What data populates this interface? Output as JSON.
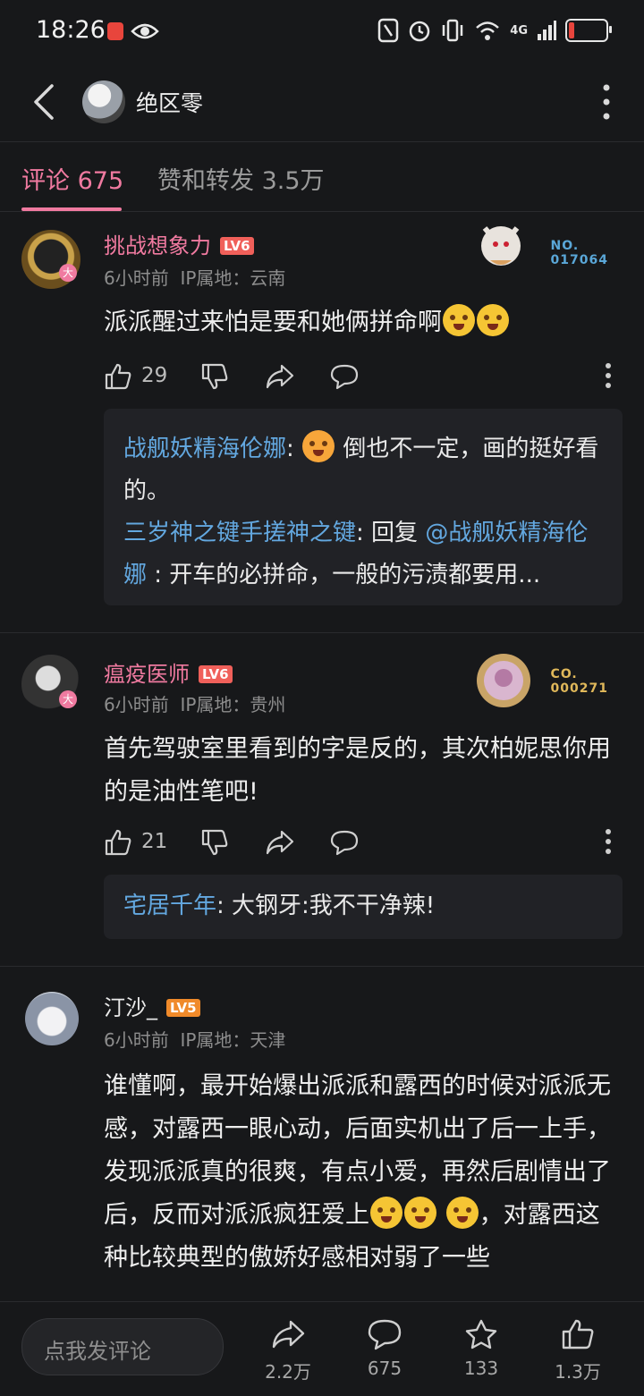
{
  "status_bar": {
    "time": "18:26",
    "network": "4G"
  },
  "header": {
    "title": "绝区零"
  },
  "tabs": [
    {
      "label": "评论 675"
    },
    {
      "label": "赞和转发 3.5万"
    }
  ],
  "comments": [
    {
      "username": "挑战想象力",
      "level": "LV6",
      "time": "6小时前",
      "ip": "IP属地：云南",
      "text": "派派醒过来怕是要和她俩拼命啊",
      "likes": "29",
      "badge_no": "NO.",
      "badge_num": "017064",
      "replies": [
        {
          "name": "战舰妖精海伦娜",
          "text": "倒也不一定，画的挺好看的。"
        },
        {
          "name": "三岁神之键手搓神之键",
          "text_prefix": "回复 ",
          "mention": "@战舰妖精海伦娜",
          "text": " : 开车的必拼命，一般的污渍都要用..."
        }
      ]
    },
    {
      "username": "瘟疫医师",
      "level": "LV6",
      "time": "6小时前",
      "ip": "IP属地：贵州",
      "text": "首先驾驶室里看到的字是反的，其次柏妮思你用的是油性笔吧!",
      "likes": "21",
      "badge_no": "CO.",
      "badge_num": "000271",
      "replies": [
        {
          "name": "宅居千年",
          "text": "大钢牙:我不干净辣!"
        }
      ]
    },
    {
      "username": "汀沙_",
      "level": "LV5",
      "time": "6小时前",
      "ip": "IP属地：天津",
      "text_part1": "谁懂啊，最开始爆出派派和露西的时候对派派无感，对露西一眼心动，后面实机出了后一上手，发现派派真的很爽，有点小爱，再然后剧情出了后，反而对派派疯狂爱上",
      "text_part2": "，对露西这种比较典型的傲娇好感相对弱了一些"
    }
  ],
  "bottom_bar": {
    "placeholder": "点我发评论",
    "share_count": "2.2万",
    "comment_count": "675",
    "favorite_count": "133",
    "like_count": "1.3万"
  },
  "colors": {
    "accent": "#f07aa0",
    "link": "#63a8e0",
    "background": "#17181a"
  }
}
